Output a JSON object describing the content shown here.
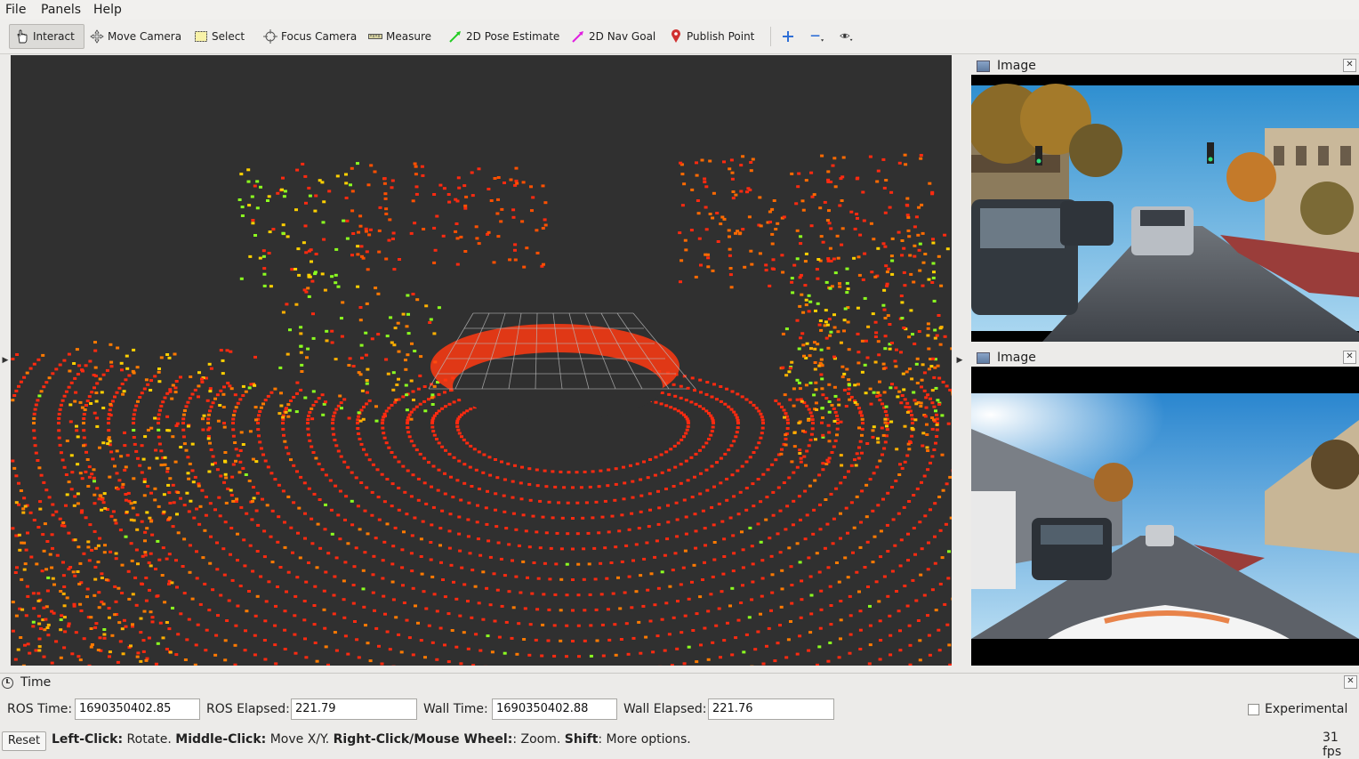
{
  "menu": [
    {
      "label": "File"
    },
    {
      "label": "Panels"
    },
    {
      "label": "Help"
    }
  ],
  "toolbar": {
    "tools": [
      {
        "label": "Interact",
        "icon": "hand-pointer-icon"
      },
      {
        "label": "Move Camera",
        "icon": "move-camera-icon"
      },
      {
        "label": "Select",
        "icon": "select-box-icon"
      },
      {
        "label": "Focus Camera",
        "icon": "focus-camera-icon"
      },
      {
        "label": "Measure",
        "icon": "ruler-icon"
      },
      {
        "label": "2D Pose Estimate",
        "icon": "green-arrow-icon"
      },
      {
        "label": "2D Nav Goal",
        "icon": "magenta-arrow-icon"
      },
      {
        "label": "Publish Point",
        "icon": "map-pin-icon"
      }
    ],
    "extra_icons": [
      "plus-icon",
      "minus-icon",
      "eye-icon"
    ],
    "colors": {
      "pose": "#22cc22",
      "nav": "#e020e0",
      "pin": "#d03030",
      "plus": "#2f6fd6"
    }
  },
  "panels": {
    "image_top": {
      "title": "Image"
    },
    "image_bottom": {
      "title": "Image"
    }
  },
  "time": {
    "title": "Time",
    "ros_time_label": "ROS Time:",
    "ros_time": "1690350402.85",
    "ros_elapsed_label": "ROS Elapsed:",
    "ros_elapsed": "221.79",
    "wall_time_label": "Wall Time:",
    "wall_time": "1690350402.88",
    "wall_elapsed_label": "Wall Elapsed:",
    "wall_elapsed": "221.76",
    "experimental_label": "Experimental"
  },
  "status": {
    "reset_label": "Reset",
    "help_1b": "Left-Click:",
    "help_1": " Rotate. ",
    "help_2b": "Middle-Click:",
    "help_2": " Move X/Y. ",
    "help_3b": "Right-Click/Mouse Wheel:",
    "help_3": ": Zoom. ",
    "help_4b": "Shift",
    "help_4": ": More options.",
    "fps": "31 fps"
  },
  "colors": {
    "viewport_bg": "#303030",
    "grid": "#b8b8b8",
    "ring_red": "#ff2a10",
    "ring_orange": "#ff7a00",
    "lidar_green": "#8cff20"
  }
}
